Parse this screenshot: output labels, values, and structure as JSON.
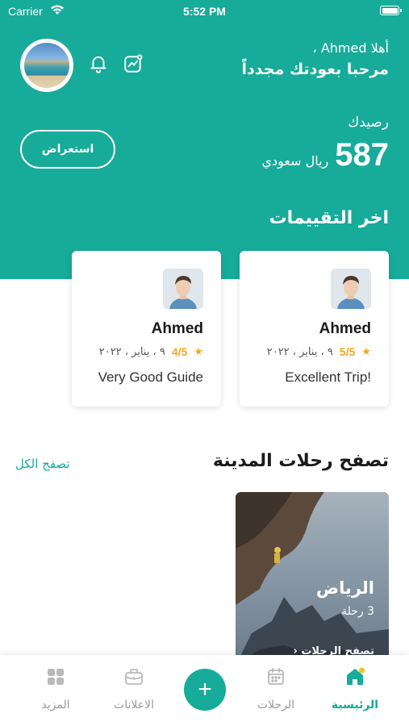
{
  "status_bar": {
    "carrier": "Carrier",
    "time": "5:52 PM"
  },
  "header": {
    "greeting": "أهلا Ahmed ،",
    "welcome": "مرحبا بعودتك مجدداً",
    "balance_label": "رصيدك",
    "balance_amount": "587",
    "balance_currency": "ريال سعودي",
    "review_button": "استعراض"
  },
  "reviews": {
    "title": "اخر التقييمات",
    "items": [
      {
        "name": "Ahmed",
        "rating": "5/5",
        "date": "٩ ، يناير ، ٢٠٢٢",
        "comment": "Excellent Trip!"
      },
      {
        "name": "Ahmed",
        "rating": "4/5",
        "date": "٩ ، يناير ، ٢٠٢٢",
        "comment": "Very Good Guide"
      }
    ]
  },
  "trips": {
    "title": "تصفح رحلات المدينة",
    "view_all": "تصفح الكل",
    "items": [
      {
        "city": "الرياض",
        "count": "3 رحلة",
        "browse": "تصفح الرحلات"
      }
    ]
  },
  "bottom_nav": {
    "home": "الرئيسية",
    "trips": "الرحلات",
    "ads": "الاعلانات",
    "more": "المزيد",
    "add": "+"
  },
  "colors": {
    "primary": "#17ab9a",
    "star": "#f5a623"
  }
}
